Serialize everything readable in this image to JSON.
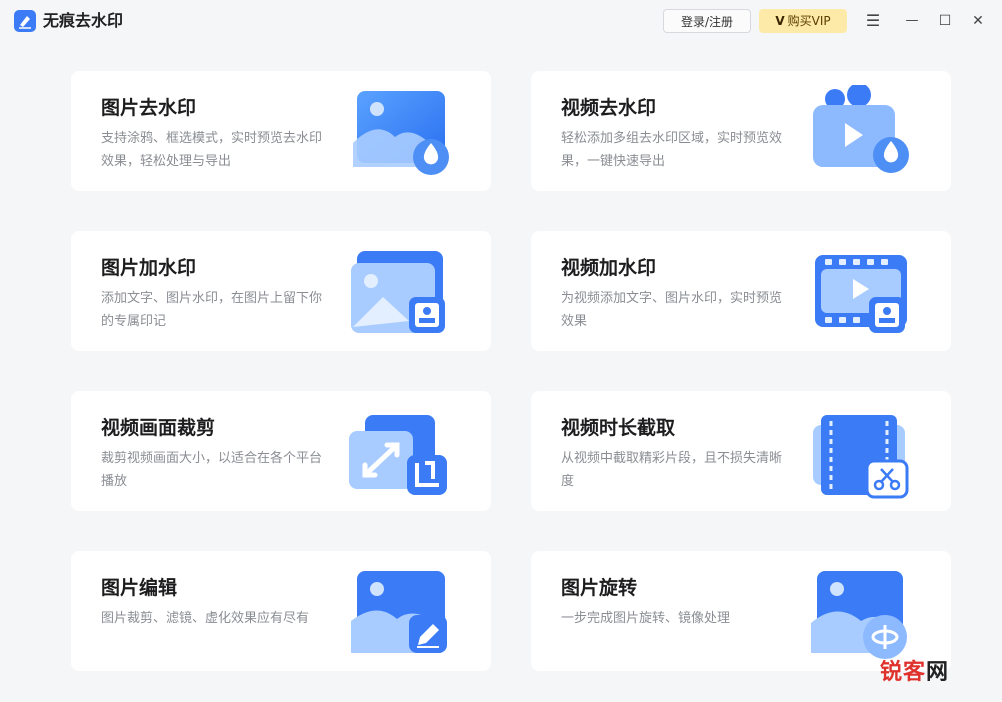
{
  "app": {
    "title": "无痕去水印"
  },
  "header": {
    "login_label": "登录/注册",
    "vip_mark": "V",
    "vip_label": "购买VIP"
  },
  "window_controls": {
    "menu": "☰",
    "minimize": "—",
    "maximize": "☐",
    "close": "✕"
  },
  "cards": [
    {
      "title": "图片去水印",
      "desc": "支持涂鸦、框选模式，实时预览去水印效果，轻松处理与导出",
      "icon": "image-droplet-icon"
    },
    {
      "title": "视频去水印",
      "desc": "轻松添加多组去水印区域，实时预览效果，一键快速导出",
      "icon": "video-droplet-icon"
    },
    {
      "title": "图片加水印",
      "desc": "添加文字、图片水印，在图片上留下你的专属印记",
      "icon": "image-stamp-icon"
    },
    {
      "title": "视频加水印",
      "desc": "为视频添加文字、图片水印，实时预览效果",
      "icon": "video-stamp-icon"
    },
    {
      "title": "视频画面裁剪",
      "desc": "裁剪视频画面大小，以适合在各个平台播放",
      "icon": "crop-resize-icon"
    },
    {
      "title": "视频时长截取",
      "desc": "从视频中截取精彩片段，且不损失清晰度",
      "icon": "film-scissors-icon"
    },
    {
      "title": "图片编辑",
      "desc": "图片裁剪、滤镜、虚化效果应有尽有",
      "icon": "image-edit-icon"
    },
    {
      "title": "图片旋转",
      "desc": "一步完成图片旋转、镜像处理",
      "icon": "image-rotate-icon"
    }
  ],
  "watermark": {
    "part1": "锐",
    "part2": "客",
    "part3": "网"
  },
  "colors": {
    "accent": "#3b7bf6",
    "vip_bg": "#fde9a8",
    "page_bg": "#f5f6f8"
  }
}
